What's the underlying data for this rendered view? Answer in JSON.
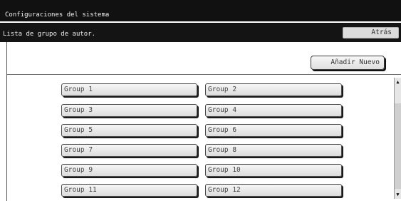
{
  "window": {
    "title": "Configuraciones del sistema"
  },
  "subheader": {
    "title": "Lista de grupo de autor.",
    "back_label": "Atrás"
  },
  "toolbar": {
    "add_new_label": "Añadir Nuevo"
  },
  "groups": [
    "Group 1",
    "Group 2",
    "Group 3",
    "Group 4",
    "Group 5",
    "Group 6",
    "Group 7",
    "Group 8",
    "Group 9",
    "Group 10",
    "Group 11",
    "Group 12"
  ],
  "scrollbar": {
    "up_icon": "triangle-up",
    "down_icon": "triangle-down"
  }
}
